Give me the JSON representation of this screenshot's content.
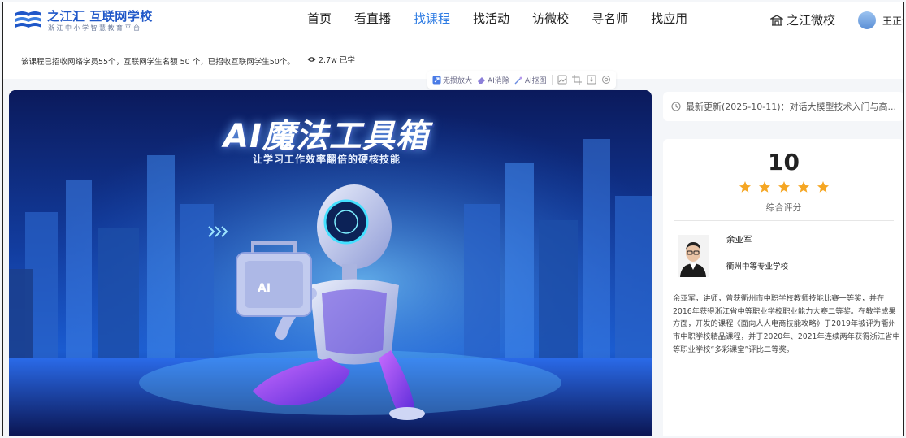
{
  "header": {
    "logo_title": "之江汇 互联网学校",
    "logo_subtitle": "浙江中小学智慧教育平台",
    "nav": [
      {
        "label": "首页",
        "active": false
      },
      {
        "label": "看直播",
        "active": false
      },
      {
        "label": "找课程",
        "active": true
      },
      {
        "label": "找活动",
        "active": false
      },
      {
        "label": "访微校",
        "active": false
      },
      {
        "label": "寻名师",
        "active": false
      },
      {
        "label": "找应用",
        "active": false
      }
    ],
    "school_link": "之江微校",
    "user_name": "王正请"
  },
  "info_bar": {
    "enrollment_text": "该课程已招收网络学员55个，互联网学生名额 50 个，已招收互联网学生50个。",
    "views": "2.7w 已学"
  },
  "toolbar": {
    "tools": [
      "无损放大",
      "AI消除",
      "AI抠图"
    ],
    "icons": [
      "image-tool-icon",
      "crop-icon",
      "download-icon",
      "settings-icon"
    ]
  },
  "poster": {
    "title": "AI魔法工具箱",
    "subtitle": "让学习工作效率翻倍的硬核技能",
    "toolbox_label": "AI"
  },
  "update": {
    "text": "最新更新(2025-10-11)：对话大模型技术入门与高..."
  },
  "rating": {
    "score": "10",
    "stars": 5,
    "label": "综合评分"
  },
  "teacher": {
    "name": "余亚军",
    "school": "衢州中等专业学校",
    "bio": "余亚军，讲师，曾获衢州市中职学校教师技能比赛一等奖，并在2016年获得浙江省中等职业学校职业能力大赛二等奖。在教学成果方面，开发的课程《面向人人电商技能攻略》于2019年被评为衢州市中职学校精品课程，并于2020年、2021年连续两年获得浙江省中等职业学校“多彩课堂”评比二等奖。"
  },
  "colors": {
    "accent": "#2d7be3",
    "star": "#f5a623",
    "brand": "#1f57c8"
  }
}
